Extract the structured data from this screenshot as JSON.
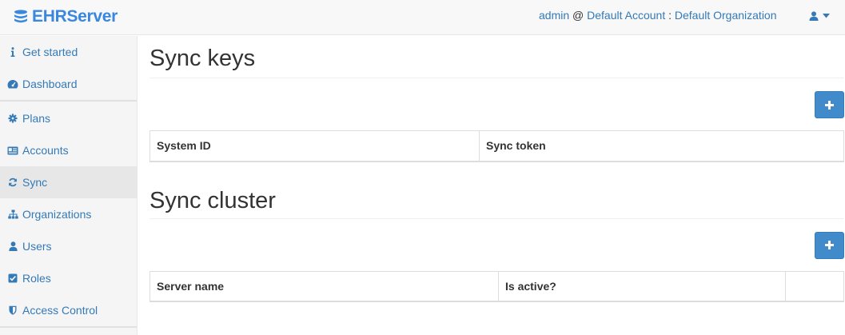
{
  "app": {
    "brand": "EHRServer",
    "brand_color": "#3a87e0",
    "link_color": "#337ab7"
  },
  "header": {
    "user": "admin",
    "separator": "@",
    "account": "Default Account",
    "colon": ":",
    "organization": "Default Organization",
    "user_menu_icon": "user-icon"
  },
  "sidebar": {
    "groups": [
      [
        {
          "label": "Get started",
          "icon": "info-icon"
        },
        {
          "label": "Dashboard",
          "icon": "dashboard-icon"
        }
      ],
      [
        {
          "label": "Plans",
          "icon": "gear-icon"
        },
        {
          "label": "Accounts",
          "icon": "id-card-icon"
        },
        {
          "label": "Sync",
          "icon": "refresh-icon",
          "active": true
        },
        {
          "label": "Organizations",
          "icon": "sitemap-icon"
        },
        {
          "label": "Users",
          "icon": "user-icon"
        },
        {
          "label": "Roles",
          "icon": "check-square-icon"
        },
        {
          "label": "Access Control",
          "icon": "shield-icon"
        }
      ]
    ]
  },
  "sync_keys": {
    "title": "Sync keys",
    "columns": [
      "System ID",
      "Sync token"
    ]
  },
  "sync_cluster": {
    "title": "Sync cluster",
    "columns": [
      "Server name",
      "Is active?",
      ""
    ]
  }
}
